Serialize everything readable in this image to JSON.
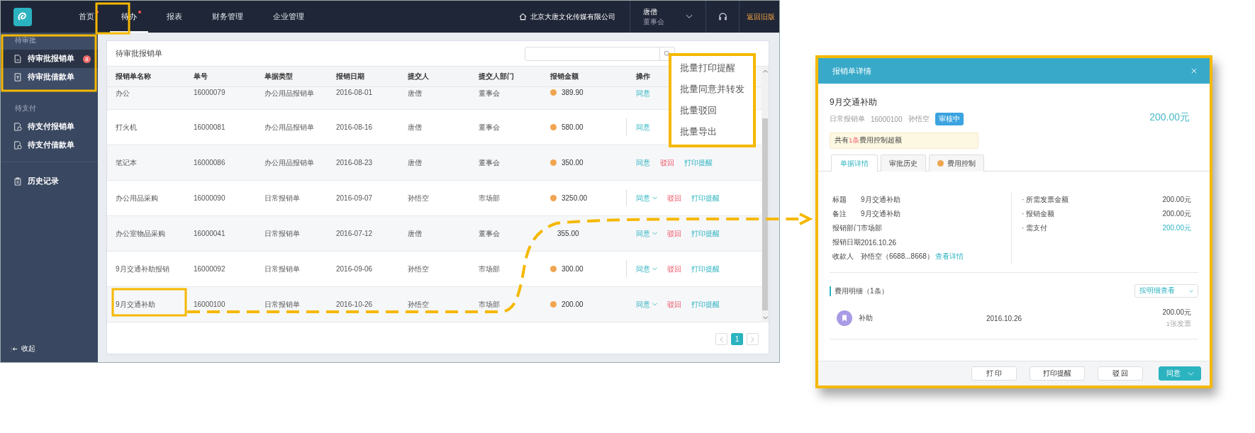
{
  "nav": {
    "tabs": [
      {
        "label": "首页",
        "selected": false,
        "dot": true
      },
      {
        "label": "待办",
        "selected": true,
        "dot": true
      },
      {
        "label": "报表",
        "selected": false,
        "dot": false
      },
      {
        "label": "财务管理",
        "selected": false,
        "dot": false
      },
      {
        "label": "企业管理",
        "selected": false,
        "dot": false
      }
    ],
    "company": "北京大唐文化传媒有限公司",
    "user": {
      "name": "唐僧",
      "role": "董事会"
    },
    "legacy_link": "返回旧版"
  },
  "sidebar": {
    "sections": [
      {
        "title": "待审批",
        "items": [
          {
            "label": "待审批报销单",
            "selected": true,
            "badge": "8"
          },
          {
            "label": "待审批借款单",
            "selected": false
          }
        ]
      },
      {
        "title": "待支付",
        "items": [
          {
            "label": "待支付报销单",
            "selected": false
          },
          {
            "label": "待支付借款单",
            "selected": false
          }
        ]
      },
      {
        "items": [
          {
            "label": "历史记录",
            "selected": false
          }
        ]
      }
    ],
    "collapse": "收起"
  },
  "card": {
    "title": "待审批报销单",
    "batch_menu": [
      "批量打印提醒",
      "批量同意并转发",
      "批量驳回",
      "批量导出"
    ],
    "table": {
      "columns": [
        "报销单名称",
        "单号",
        "单据类型",
        "报销日期",
        "提交人",
        "提交人部门",
        "报销金额",
        "操作"
      ],
      "rows": [
        {
          "cells": [
            "办公",
            "16000079",
            "办公用品报销单",
            "2016-08-01",
            "唐僧",
            "董事会"
          ],
          "amount": "389.90",
          "coin": true,
          "divider": false,
          "actions": [
            {
              "label": "同意",
              "kind": "agree",
              "dropdown": false
            }
          ]
        },
        {
          "cells": [
            "打火机",
            "16000081",
            "办公用品报销单",
            "2016-08-16",
            "唐僧",
            "董事会"
          ],
          "amount": "580.00",
          "coin": true,
          "divider": true,
          "actions": [
            {
              "label": "同意",
              "kind": "agree",
              "dropdown": false
            }
          ]
        },
        {
          "cells": [
            "笔记本",
            "16000086",
            "办公用品报销单",
            "2016-08-23",
            "唐僧",
            "董事会"
          ],
          "amount": "350.00",
          "coin": true,
          "divider": false,
          "actions": [
            {
              "label": "同意",
              "kind": "agree",
              "dropdown": false
            },
            {
              "label": "驳回",
              "kind": "reject",
              "dropdown": false
            },
            {
              "label": "打印提醒",
              "kind": "print",
              "dropdown": false
            }
          ]
        },
        {
          "cells": [
            "办公用品采购",
            "16000090",
            "日常报销单",
            "2016-09-07",
            "孙悟空",
            "市场部"
          ],
          "amount": "3250.00",
          "coin": true,
          "divider": true,
          "actions": [
            {
              "label": "同意",
              "kind": "agree",
              "dropdown": true
            },
            {
              "label": "驳回",
              "kind": "reject",
              "dropdown": false
            },
            {
              "label": "打印提醒",
              "kind": "print",
              "dropdown": false
            }
          ]
        },
        {
          "cells": [
            "办公室物品采购",
            "16000041",
            "日常报销单",
            "2016-07-12",
            "唐僧",
            "董事会"
          ],
          "amount": "355.00",
          "coin": false,
          "divider": false,
          "actions": [
            {
              "label": "同意",
              "kind": "agree",
              "dropdown": true
            },
            {
              "label": "驳回",
              "kind": "reject",
              "dropdown": false
            },
            {
              "label": "打印提醒",
              "kind": "print",
              "dropdown": false
            }
          ]
        },
        {
          "cells": [
            "9月交通补助报销",
            "16000092",
            "日常报销单",
            "2016-09-06",
            "孙悟空",
            "市场部"
          ],
          "amount": "300.00",
          "coin": true,
          "divider": true,
          "actions": [
            {
              "label": "同意",
              "kind": "agree",
              "dropdown": true
            },
            {
              "label": "驳回",
              "kind": "reject",
              "dropdown": false
            },
            {
              "label": "打印提醒",
              "kind": "print",
              "dropdown": false
            }
          ]
        },
        {
          "cells": [
            "9月交通补助",
            "16000100",
            "日常报销单",
            "2016-10-26",
            "孙悟空",
            "市场部"
          ],
          "amount": "200.00",
          "coin": true,
          "divider": false,
          "actions": [
            {
              "label": "同意",
              "kind": "agree",
              "dropdown": true
            },
            {
              "label": "驳回",
              "kind": "reject",
              "dropdown": false
            },
            {
              "label": "打印提醒",
              "kind": "print",
              "dropdown": false
            }
          ]
        }
      ]
    },
    "pages": [
      {
        "label": "1",
        "selected": true
      }
    ]
  },
  "detail": {
    "header": "报销单详情",
    "title": "9月交通补助",
    "meta": [
      "日常报销单",
      "16000100",
      "孙悟空"
    ],
    "status": "审核中",
    "total": "200.00元",
    "warning": {
      "before": "共有",
      "count": "1条",
      "after": "费用控制超额"
    },
    "tabs": [
      {
        "label": "单据详情",
        "selected": true,
        "warning": false
      },
      {
        "label": "审批历史",
        "selected": false,
        "warning": false
      },
      {
        "label": "费用控制",
        "selected": false,
        "warning": true
      }
    ],
    "fields": [
      {
        "label": "标题",
        "value": "9月交通补助"
      },
      {
        "label": "备注",
        "value": "9月交通补助"
      },
      {
        "label": "报销部门",
        "value": "市场部"
      },
      {
        "label": "报销日期",
        "value": "2016.10.26"
      },
      {
        "label": "收款人",
        "value": "孙悟空（6688...8668）",
        "link": "查看详情"
      }
    ],
    "summary": [
      {
        "label": "· 所需发票金额",
        "value": "200.00元",
        "highlight": false
      },
      {
        "label": "· 报销金额",
        "value": "200.00元",
        "highlight": false
      },
      {
        "label": "· 需支付",
        "value": "200.00元",
        "highlight": true
      }
    ],
    "section": {
      "title": "费用明细（1条）",
      "view": "按明细查看"
    },
    "items": [
      {
        "name": "补助",
        "date": "2016.10.26",
        "amount": "200.00元",
        "note": "1张发票"
      }
    ],
    "buttons": [
      {
        "label": "打 印",
        "kind": "default"
      },
      {
        "label": "打印提醒",
        "kind": "default"
      },
      {
        "label": "驳 回",
        "kind": "default"
      },
      {
        "label": "同意",
        "kind": "primary"
      }
    ]
  }
}
